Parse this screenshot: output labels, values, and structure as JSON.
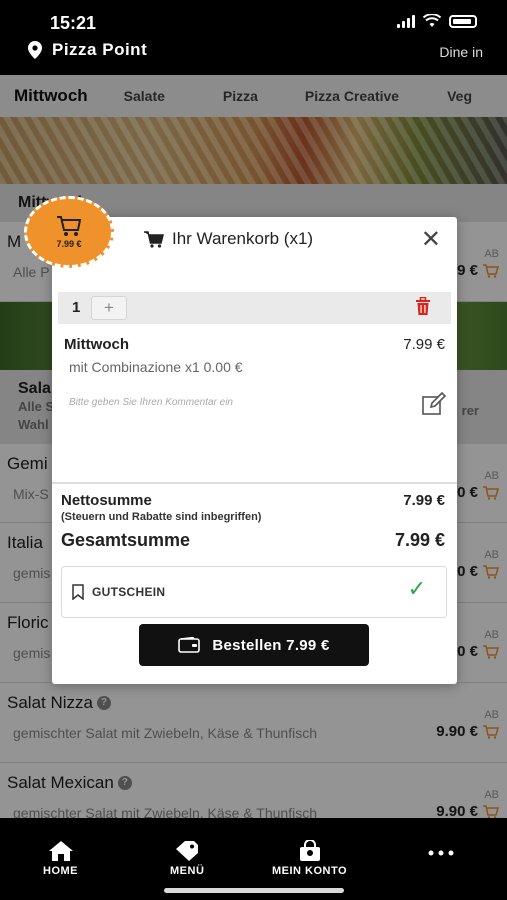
{
  "status": {
    "time": "15:21"
  },
  "header": {
    "store_name": "Pizza Point",
    "mode": "Dine in"
  },
  "tabs": [
    {
      "label": "Mittwoch"
    },
    {
      "label": "Salate"
    },
    {
      "label": "Pizza"
    },
    {
      "label": "Pizza Creative"
    },
    {
      "label": "Veg"
    }
  ],
  "background": {
    "section1": "Mittwoch",
    "item1": {
      "name": "M",
      "desc": "Alle P",
      "ab": "AB",
      "price": "9 €"
    },
    "section2": "Sala",
    "section2_desc1": "Alle S",
    "section2_desc2": "Wahl",
    "section2_right": "rer",
    "items": [
      {
        "name": "Gemi",
        "desc": "Mix-S",
        "ab": "AB",
        "price": "0 €"
      },
      {
        "name": "Italia",
        "desc": "gemis",
        "ab": "AB",
        "price": "0 €"
      },
      {
        "name": "Floric",
        "desc": "gemis",
        "ab": "AB",
        "price": "0 €"
      },
      {
        "name": "Salat Nizza",
        "desc": "gemischter Salat mit Zwiebeln, Käse & Thunfisch",
        "ab": "AB",
        "price": "9.90 €"
      },
      {
        "name": "Salat Mexican",
        "desc": "gemischter Salat mit Zwiebeln, Käse & Thunfisch",
        "ab": "AB",
        "price": "9.90 €"
      }
    ]
  },
  "cart_badge": {
    "price": "7.99 €"
  },
  "modal": {
    "title": "Ihr Warenkorb (x1)",
    "qty": "1",
    "qty_plus": "+",
    "line": {
      "name": "Mittwoch",
      "price": "7.99 €",
      "sub": "mit Combinazione x1 0.00 €",
      "comment_placeholder": "Bitte geben Sie Ihren Kommentar ein"
    },
    "netto_label": "Nettosumme",
    "netto_value": "7.99 €",
    "tax_note": "(Steuern und Rabatte sind inbegriffen)",
    "total_label": "Gesamtsumme",
    "total_value": "7.99 €",
    "voucher_label": "GUTSCHEIN",
    "order_label": "Bestellen 7.99 €"
  },
  "nav": [
    {
      "label": "HOME"
    },
    {
      "label": "MENÜ"
    },
    {
      "label": "MEIN KONTO"
    },
    {
      "label": ""
    }
  ],
  "colors": {
    "accent": "#f0922b",
    "check": "#27a846",
    "trash": "#d9241c"
  }
}
